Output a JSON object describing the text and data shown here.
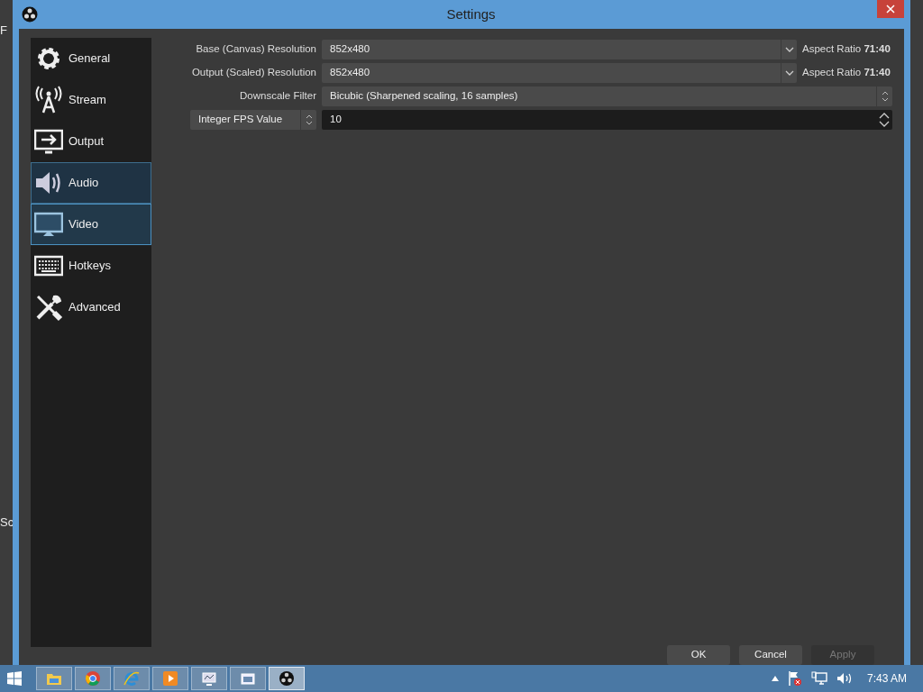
{
  "background_app": {
    "fragments": [
      "F",
      "Sc"
    ]
  },
  "window": {
    "title": "Settings"
  },
  "sidebar": {
    "items": [
      {
        "label": "General",
        "selected": false,
        "highlighted": false
      },
      {
        "label": "Stream",
        "selected": false,
        "highlighted": false
      },
      {
        "label": "Output",
        "selected": false,
        "highlighted": false
      },
      {
        "label": "Audio",
        "selected": false,
        "highlighted": true
      },
      {
        "label": "Video",
        "selected": true,
        "highlighted": false
      },
      {
        "label": "Hotkeys",
        "selected": false,
        "highlighted": false
      },
      {
        "label": "Advanced",
        "selected": false,
        "highlighted": false
      }
    ]
  },
  "video_settings": [
    {
      "kind": "combo",
      "label": "Base (Canvas) Resolution",
      "value": "852x480",
      "note": "Aspect Ratio **71:40**"
    },
    {
      "kind": "select",
      "label": "Output (Scaled) Resolution",
      "value": "852x480",
      "note": "Aspect Ratio **71:40**"
    },
    {
      "kind": "updown",
      "label": "Downscale Filter",
      "value": "Bicubic (Sharpened scaling, 16 samples)"
    },
    {
      "kind": "spin",
      "label": "Integer FPS Value",
      "value": "10"
    }
  ],
  "buttons": [
    {
      "label": "OK",
      "disabled": false
    },
    {
      "label": "Cancel",
      "disabled": false
    },
    {
      "label": "Apply",
      "disabled": true
    }
  ],
  "taskbar": {
    "apps": [
      {
        "selected": false
      },
      {
        "selected": false
      },
      {
        "selected": false
      },
      {
        "selected": false
      },
      {
        "selected": false
      },
      {
        "selected": false
      },
      {
        "selected": true
      }
    ],
    "clock": "7:43 AM"
  }
}
